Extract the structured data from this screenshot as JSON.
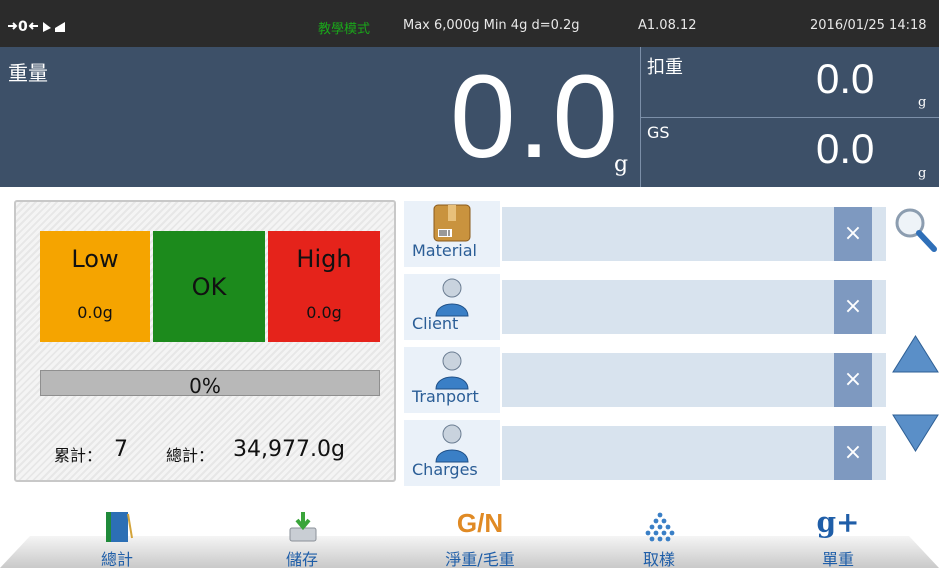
{
  "status_bar": {
    "zero_indicator": "→ 0 ←",
    "mode": "教學模式",
    "capacity": "Max 6,000g  Min 4g  d=0.2g",
    "firmware": "A1.08.12",
    "datetime": "2016/01/25  14:18",
    "mode_color": "#1aa61a"
  },
  "weight_panel": {
    "label": "重量",
    "value": "0.0",
    "unit": "g",
    "tare_label": "扣重",
    "tare_value": "0.0",
    "tare_unit": "g",
    "gs_label": "GS",
    "gs_value": "0.0",
    "gs_unit": "g"
  },
  "check_panel": {
    "low_label": "Low",
    "low_value": "0.0g",
    "ok_label": "OK",
    "high_label": "High",
    "high_value": "0.0g",
    "progress_text": "0%",
    "progress_fraction": 0.0,
    "count_label": "累計：",
    "count_value": "7",
    "total_label": "總計：",
    "total_value": "34,977.0g",
    "colors": {
      "low": "#f5a400",
      "ok": "#1c8a1c",
      "high": "#e5231b"
    }
  },
  "fields": [
    {
      "name": "Material",
      "icon": "package-icon",
      "value": "",
      "clear": "×"
    },
    {
      "name": "Client",
      "icon": "person-icon",
      "value": "",
      "clear": "×"
    },
    {
      "name": "Tranport",
      "icon": "person-icon",
      "value": "",
      "clear": "×"
    },
    {
      "name": "Charges",
      "icon": "person-icon",
      "value": "",
      "clear": "×"
    }
  ],
  "side_controls": {
    "search_icon": "magnifier-icon",
    "up_icon": "triangle-up-icon",
    "down_icon": "triangle-down-icon"
  },
  "toolbar": {
    "items": [
      {
        "label": "總計",
        "icon": "book-icon"
      },
      {
        "label": "儲存",
        "icon": "save-icon"
      },
      {
        "label": "淨重/毛重",
        "icon_text": "G/N"
      },
      {
        "label": "取樣",
        "icon": "sample-dots-icon"
      },
      {
        "label": "單重",
        "icon_text": "g+"
      }
    ]
  }
}
